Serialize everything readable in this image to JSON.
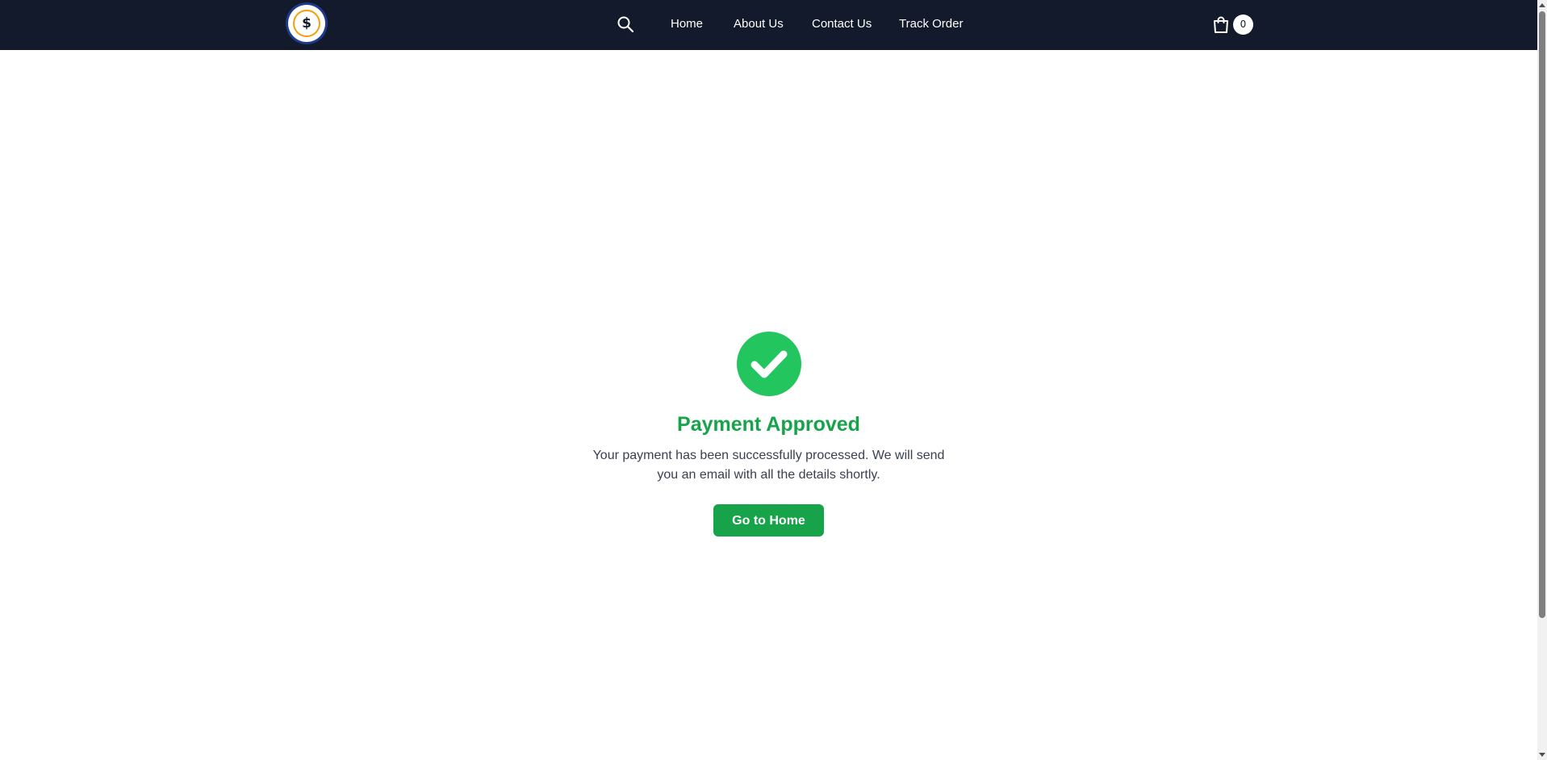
{
  "navbar": {
    "logo_symbol": "$",
    "links": [
      "Home",
      "About Us",
      "Contact Us",
      "Track Order"
    ],
    "cart_count": "0",
    "search_icon": "search-icon",
    "cart_icon": "shopping-bag-icon"
  },
  "confirmation": {
    "icon": "check-circle-icon",
    "title": "Payment Approved",
    "message": "Your payment has been successfully processed. We will send you an email with all the details shortly.",
    "button_label": "Go to Home"
  },
  "colors": {
    "navbar_bg": "#121a2b",
    "success_green": "#22c55e",
    "title_green": "#16a34a",
    "button_green": "#16a34a",
    "logo_ring": "#f59e0b"
  }
}
